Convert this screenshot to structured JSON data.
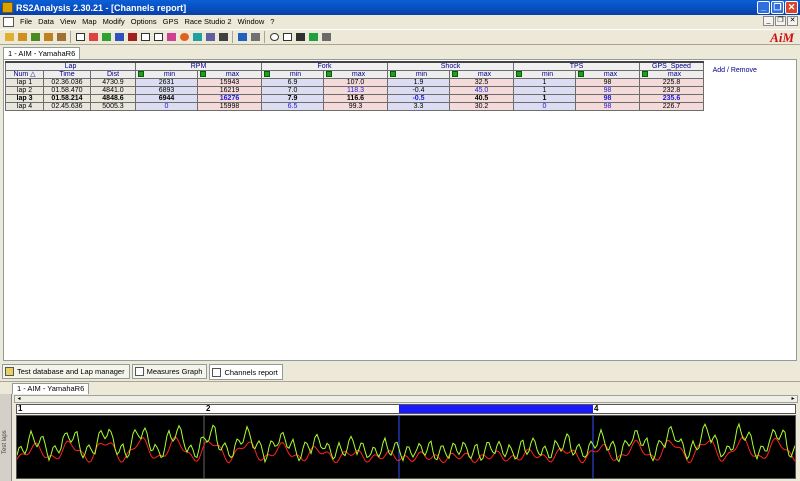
{
  "window": {
    "title": "RS2Analysis 2.30.21 - [Channels report]"
  },
  "menu": [
    "File",
    "Data",
    "View",
    "Map",
    "Modify",
    "Options",
    "GPS",
    "Race Studio 2",
    "Window",
    "?"
  ],
  "brand": "AiM",
  "doc_tab": "1 - AIM - YamahaR6",
  "table": {
    "group_headers": {
      "lap": "Lap",
      "rpm": "RPM",
      "fork": "Fork",
      "shock": "Shock",
      "tps": "TPS",
      "gps_speed": "GPS_Speed",
      "add_remove": "Add / Remove"
    },
    "sub_headers": {
      "num": "Num",
      "time": "Time",
      "dist": "Dist",
      "min": "min",
      "max": "max"
    },
    "rows": [
      {
        "lap": "lap 1",
        "time": "02.36.036",
        "dist": "4730.9",
        "rpm_min": "2631",
        "rpm_max": "15943",
        "fork_min": "6.9",
        "fork_max": "107.0",
        "shock_min": "1.9",
        "shock_max": "32.5",
        "tps_min": "1",
        "tps_max": "98",
        "gps_max": "225.8"
      },
      {
        "lap": "lap 2",
        "time": "01.58.470",
        "dist": "4841.0",
        "rpm_min": "6893",
        "rpm_max": "16219",
        "fork_min": "7.0",
        "fork_max": "118.3",
        "shock_min": "-0.4",
        "shock_max": "45.0",
        "tps_min": "1",
        "tps_max": "98",
        "gps_max": "232.8"
      },
      {
        "lap": "lap 3",
        "time": "01.58.214",
        "dist": "4848.6",
        "rpm_min": "6944",
        "rpm_max": "16276",
        "fork_min": "7.9",
        "fork_max": "116.6",
        "shock_min": "-0.5",
        "shock_max": "40.5",
        "tps_min": "1",
        "tps_max": "98",
        "gps_max": "235.6"
      },
      {
        "lap": "lap 4",
        "time": "02.45.636",
        "dist": "5005.3",
        "rpm_min": "0",
        "rpm_max": "15998",
        "fork_min": "6.5",
        "fork_max": "99.3",
        "shock_min": "3.3",
        "shock_max": "30.2",
        "tps_min": "0",
        "tps_max": "98",
        "gps_max": "226.7"
      }
    ]
  },
  "bottom_tabs": [
    "Test database and Lap manager",
    "Measures Graph",
    "Channels report"
  ],
  "lower_panel": {
    "tab": "1 - AIM - YamahaR6",
    "side_label": "Test laps",
    "lap_markers": [
      "1",
      "2",
      "4"
    ]
  },
  "colors": {
    "trace_green": "#a8ff30",
    "trace_red": "#ff2020",
    "selection": "#1a1aff"
  }
}
